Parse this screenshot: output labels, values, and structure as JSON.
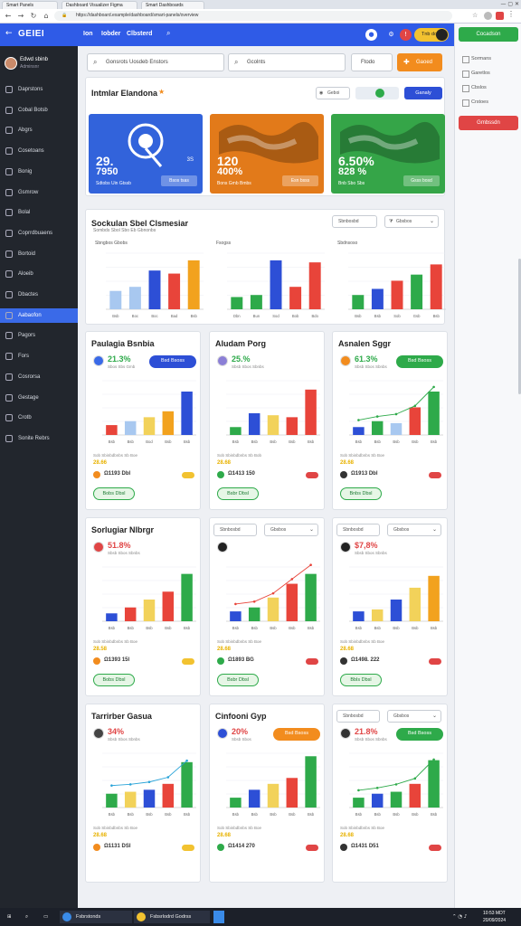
{
  "browser": {
    "tabs": [
      "Smart Panels",
      "Dashboard Visualizer Figma",
      "Smart Dashboards"
    ],
    "url": "https://dashboard.example/dashboard/smart-panels/overview"
  },
  "header": {
    "logo": "GEIEI",
    "nav": [
      "Ion",
      "Iobder",
      "Clbsterd"
    ],
    "badge": "Tnb dct"
  },
  "sidebar": {
    "user_name": "Edwd sbinb",
    "user_role": "Adminsnr",
    "items": [
      "Daprstons",
      "Cobal Botsb",
      "Abgrs",
      "Cosetoans",
      "Bonig",
      "Gsmrow",
      "Bolal",
      "Coprrdbuaens",
      "Bortoid",
      "Aloeib",
      "Dbactes",
      "Aabaofon",
      "Pagors",
      "Fors",
      "Cosrorsa",
      "Gestage",
      "Crotb",
      "Sonite Rebrs"
    ],
    "active_index": 11
  },
  "toolbar": {
    "search1": "Gonsrots Uosdeb Enstors",
    "search2": "Gcolnts",
    "filter": "Ftodo",
    "action": "Gaoed"
  },
  "right_panel": {
    "top_button": "Cocadson",
    "items": [
      "Sormans",
      "Garetlos",
      "Cbslos",
      "Crstoes"
    ],
    "alert_button": "Gmbssdn",
    "colors": {
      "green": "#2eaa4a",
      "red": "#e04545"
    }
  },
  "overview": {
    "title": "Intmlar Elandona",
    "view_label": "Geboi",
    "primary_button": "Ganaly",
    "kpis": [
      {
        "big": "29.",
        "big2": "7950",
        "small": "3S",
        "label": "Sdtobs Uin Gtssb",
        "button": "Bsos tsas",
        "color": "#3263db"
      },
      {
        "big": "120",
        "big2": "400%",
        "small": "",
        "label": "Bons Gmb Bmbs",
        "button": "Esn bsss",
        "color": "#e27a1a"
      },
      {
        "big": "6.50%",
        "big2": "828 %",
        "small": "",
        "label": "Bnb Sbo Sbs",
        "button": "Gsss bosd",
        "color": "#35a548"
      }
    ]
  },
  "sales_section": {
    "title": "Sockulan Sbel Clsmesiar",
    "subtitle": "Sombds Sbol Sbo Eb Gbnonbs",
    "select1": "Sbnbosbd",
    "select2": "Gbsbos",
    "mini_charts": [
      {
        "title": "Sbngbos Gbobs",
        "categories": [
          "Bsb",
          "Boc",
          "Boc",
          "Bad",
          "Bsb"
        ],
        "values": [
          18,
          22,
          38,
          35,
          48
        ],
        "colors": [
          "#a8c8f0",
          "#a8c8f0",
          "#2d4fd6",
          "#e8443a",
          "#f2a21e"
        ]
      },
      {
        "title": "Fsogss",
        "categories": [
          "Dbn",
          "Bun",
          "Sod",
          "Bob",
          "Bdo"
        ],
        "values": [
          12,
          14,
          48,
          22,
          46
        ],
        "colors": [
          "#2eaa4a",
          "#2eaa4a",
          "#2d4fd6",
          "#e8443a",
          "#e8443a"
        ]
      },
      {
        "title": "Sbdnsoso",
        "categories": [
          "Bsb",
          "Bsb",
          "Sob",
          "Gsb",
          "Bsb"
        ],
        "values": [
          14,
          20,
          28,
          34,
          44
        ],
        "colors": [
          "#2eaa4a",
          "#2d4fd6",
          "#e8443a",
          "#2eaa4a",
          "#e8443a"
        ]
      }
    ]
  },
  "cards": [
    {
      "title": "Paulagia Bsnbia",
      "pct": "21.3%",
      "pct_color": "#2eaa4a",
      "note": "Sbos Sbs Gmb",
      "button": "Bsd Bsoss",
      "button_color": "#2d4fd6",
      "categories": [
        "Bsb",
        "Bsb",
        "Bod",
        "Bsb",
        "Bsb"
      ],
      "values": [
        10,
        14,
        18,
        24,
        44
      ],
      "colors": [
        "#e8443a",
        "#a8c8f0",
        "#f2d25a",
        "#f2a21e",
        "#2d4fd6"
      ],
      "caption": "Sob Sbinbdbnbs Sb Boe",
      "value_line": "28.66",
      "footer": "Ω1193 Dbl",
      "link": "Bobs Dbsl",
      "line": false
    },
    {
      "title": "Aludam Porg",
      "pct": "25.%",
      "pct_color": "#2eaa4a",
      "note": "Sbsb Sbos Sbnbs",
      "button": "",
      "button_color": "",
      "categories": [
        "Bsb",
        "Bsb",
        "Bsb",
        "Bsb",
        "Bsb"
      ],
      "values": [
        8,
        22,
        20,
        18,
        46
      ],
      "colors": [
        "#2eaa4a",
        "#2d4fd6",
        "#f2d25a",
        "#e8443a",
        "#e8443a"
      ],
      "caption": "Sob Sbinbdbnbs Sb Bob",
      "value_line": "28.68",
      "footer": "Ω1413 150",
      "link": "Bsbr Dbsl",
      "line": false
    },
    {
      "title": "Asnalen Sggr",
      "pct": "61.3%",
      "pct_color": "#2eaa4a",
      "note": "Sbsb Sbos Sbnbs",
      "button": "Bsd Bsoss",
      "button_color": "#2eaa4a",
      "categories": [
        "Bsb",
        "Bsb",
        "Bsb",
        "Bsb",
        "Bsb"
      ],
      "values": [
        8,
        14,
        12,
        28,
        44
      ],
      "colors": [
        "#2d4fd6",
        "#2eaa4a",
        "#a8c8f0",
        "#e8443a",
        "#2eaa4a"
      ],
      "caption": "Sob Sbinbdbnbs Sb Boe",
      "value_line": "28.68",
      "footer": "Ω1913 Dbl",
      "link": "Bnbs Dbsl",
      "line": true,
      "line_color": "#2eaa4a"
    },
    {
      "title": "Sorlugiar Nlbrgr",
      "pct": "51.8%",
      "pct_color": "#e04545",
      "note": "Sbsb Sbos Sbnbs",
      "button": "",
      "button_color": "",
      "categories": [
        "Bsb",
        "Bsb",
        "Bsb",
        "Bsb",
        "Bsb"
      ],
      "values": [
        8,
        14,
        22,
        30,
        48
      ],
      "colors": [
        "#2d4fd6",
        "#e8443a",
        "#f2d25a",
        "#e8443a",
        "#2eaa4a"
      ],
      "caption": "Sob Sbinbdbnbs Sb Boe",
      "value_line": "28.58",
      "footer": "Ω1393 15l",
      "link": "Bobs Dbsl",
      "line": false
    },
    {
      "title": "",
      "pct": "",
      "pct_color": "#2eaa4a",
      "note": "",
      "button": "",
      "button_color": "",
      "categories": [
        "Bsb",
        "Bsb",
        "Bsb",
        "Bsb",
        "Bsb"
      ],
      "values": [
        10,
        14,
        24,
        38,
        48
      ],
      "colors": [
        "#2d4fd6",
        "#2eaa4a",
        "#f2d25a",
        "#e8443a",
        "#2eaa4a"
      ],
      "caption": "Sob Sbinbdbnbs Sb Boe",
      "value_line": "28.68",
      "footer": "Ω1893 BG",
      "link": "Bsbr Dbsl",
      "line": true,
      "line_color": "#e8443a"
    },
    {
      "title": "",
      "pct": "$7,8%",
      "pct_color": "#e04545",
      "note": "Sbsb Sbos Sbnbs",
      "button": "",
      "button_color": "",
      "categories": [
        "Bsb",
        "Bsb",
        "Bsb",
        "Bsb",
        "Bsb"
      ],
      "values": [
        10,
        12,
        22,
        34,
        46
      ],
      "colors": [
        "#2d4fd6",
        "#f2d25a",
        "#2d4fd6",
        "#f2d25a",
        "#f2a21e"
      ],
      "caption": "Sob Sbinbdbnbs Sb Boe",
      "value_line": "28.68",
      "footer": "Ω1498. 222",
      "link": "Bbls Dbsl",
      "line": false
    },
    {
      "title": "Tarrirber Gasua",
      "pct": "34%",
      "pct_color": "#e04545",
      "note": "Sbsb Sbos Sbnbs",
      "button": "",
      "button_color": "",
      "categories": [
        "Bsb",
        "Bsb",
        "Bsb",
        "Bsb",
        "Bsb"
      ],
      "values": [
        14,
        16,
        18,
        24,
        46
      ],
      "colors": [
        "#2eaa4a",
        "#f2d25a",
        "#2d4fd6",
        "#e8443a",
        "#2eaa4a"
      ],
      "caption": "Sob Sbinbdbnbs Sb Boe",
      "value_line": "28.68",
      "footer": "Ω1131 DSl",
      "link": "",
      "line": true,
      "line_color": "#29a3d8"
    },
    {
      "title": "Cinfooni Gyp",
      "pct": "20%",
      "pct_color": "#e04545",
      "note": "Sbsb Sbos",
      "button": "Bsd Bsoss",
      "button_color": "#f28c1e",
      "categories": [
        "Bsb",
        "Bsb",
        "Bsb",
        "Bsb",
        "Bsb"
      ],
      "values": [
        10,
        18,
        24,
        30,
        52
      ],
      "colors": [
        "#2eaa4a",
        "#2d4fd6",
        "#f2d25a",
        "#e8443a",
        "#2eaa4a"
      ],
      "caption": "Sob Sbinbdbnbs Sb Boe",
      "value_line": "28.68",
      "footer": "Ω1414 270",
      "link": "",
      "line": false
    },
    {
      "title": "",
      "pct": "21.8%",
      "pct_color": "#e04545",
      "note": "Sbsb Sbos Sbnbs",
      "button": "Bsd Bsoss",
      "button_color": "#2eaa4a",
      "categories": [
        "Bsb",
        "Bsb",
        "Bsb",
        "Bsb",
        "Bsb"
      ],
      "values": [
        10,
        14,
        16,
        24,
        48
      ],
      "colors": [
        "#2eaa4a",
        "#2d4fd6",
        "#2eaa4a",
        "#e8443a",
        "#2eaa4a"
      ],
      "caption": "Sob Sbinbdbnbs Sb Boe",
      "value_line": "28.68",
      "footer": "Ω1431 D51",
      "link": "",
      "line": true,
      "line_color": "#2eaa4a"
    }
  ],
  "card_selects": {
    "a": "Sbnbosbd",
    "b": "Gbsbos"
  },
  "taskbar": {
    "items": [
      "Fsbrstonds",
      "Fsbsrlodrd Godrss"
    ],
    "time": "10:53 MDT",
    "date": "20/09/2024"
  }
}
